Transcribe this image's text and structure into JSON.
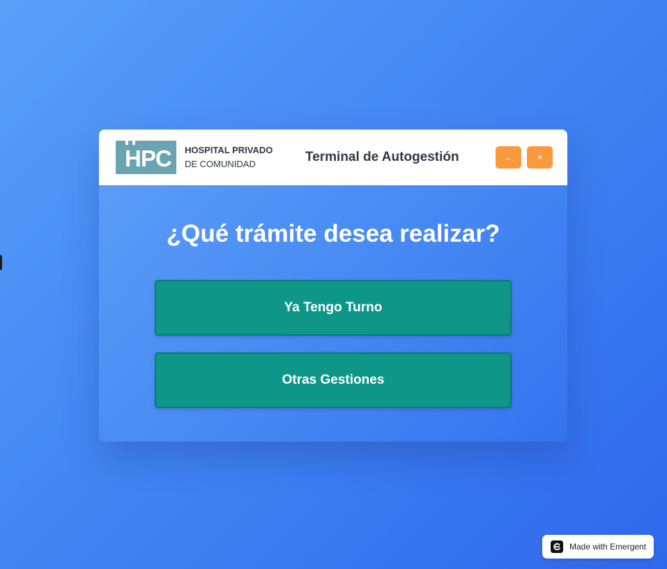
{
  "header": {
    "logo_text": "HPC",
    "hospital_name_line1": "HOSPITAL PRIVADO",
    "hospital_name_line2": "DE COMUNIDAD",
    "title": "Terminal de Autogestión",
    "back_label": "←",
    "close_label": "×"
  },
  "main": {
    "question": "¿Qué trámite desea realizar?",
    "options": [
      {
        "label": "Ya Tengo Turno"
      },
      {
        "label": "Otras Gestiones"
      }
    ]
  },
  "badge": {
    "label": "Made with Emergent",
    "icon": "emergent-logo-icon"
  },
  "colors": {
    "background_start": "#5aa0f8",
    "background_end": "#2f68ec",
    "logo": "#6aa4b0",
    "header_button": "#f99a3e",
    "option_button": "#0e9688",
    "option_border": "#0b7a72"
  }
}
